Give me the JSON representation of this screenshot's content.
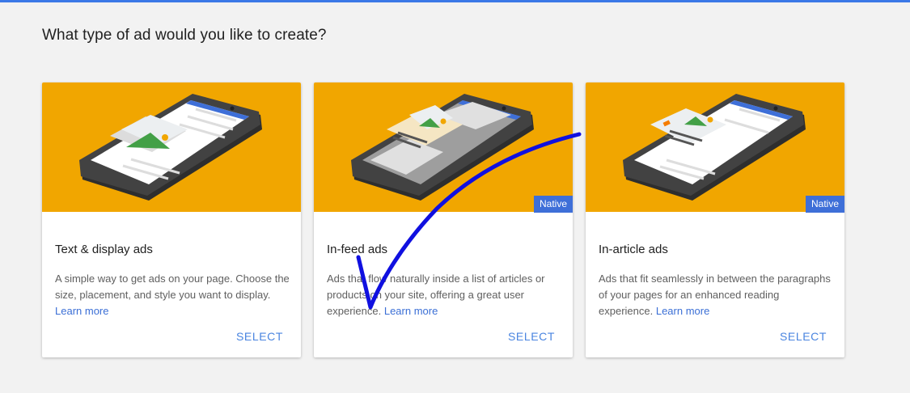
{
  "page": {
    "title": "What type of ad would you like to create?",
    "accent_color": "#3b78e7",
    "hero_color": "#f1a600"
  },
  "cards": [
    {
      "title": "Text & display ads",
      "description": "A simple way to get ads on your page. Choose the size, placement, and style you want to display.",
      "learn_more": "Learn more",
      "badge": "",
      "select_label": "SELECT",
      "illustration": "phone-display-ad-icon"
    },
    {
      "title": "In-feed ads",
      "description": "Ads that flow naturally inside a list of articles or products on your site, offering a great user experience.",
      "learn_more": "Learn more",
      "badge": "Native",
      "select_label": "SELECT",
      "illustration": "phone-infeed-ad-icon"
    },
    {
      "title": "In-article ads",
      "description": "Ads that fit seamlessly in between the paragraphs of your pages for an enhanced reading experience.",
      "learn_more": "Learn more",
      "badge": "Native",
      "select_label": "SELECT",
      "illustration": "phone-inarticle-ad-icon"
    }
  ],
  "annotation": {
    "type": "hand-drawn-checkmark",
    "color": "#1010e0"
  }
}
